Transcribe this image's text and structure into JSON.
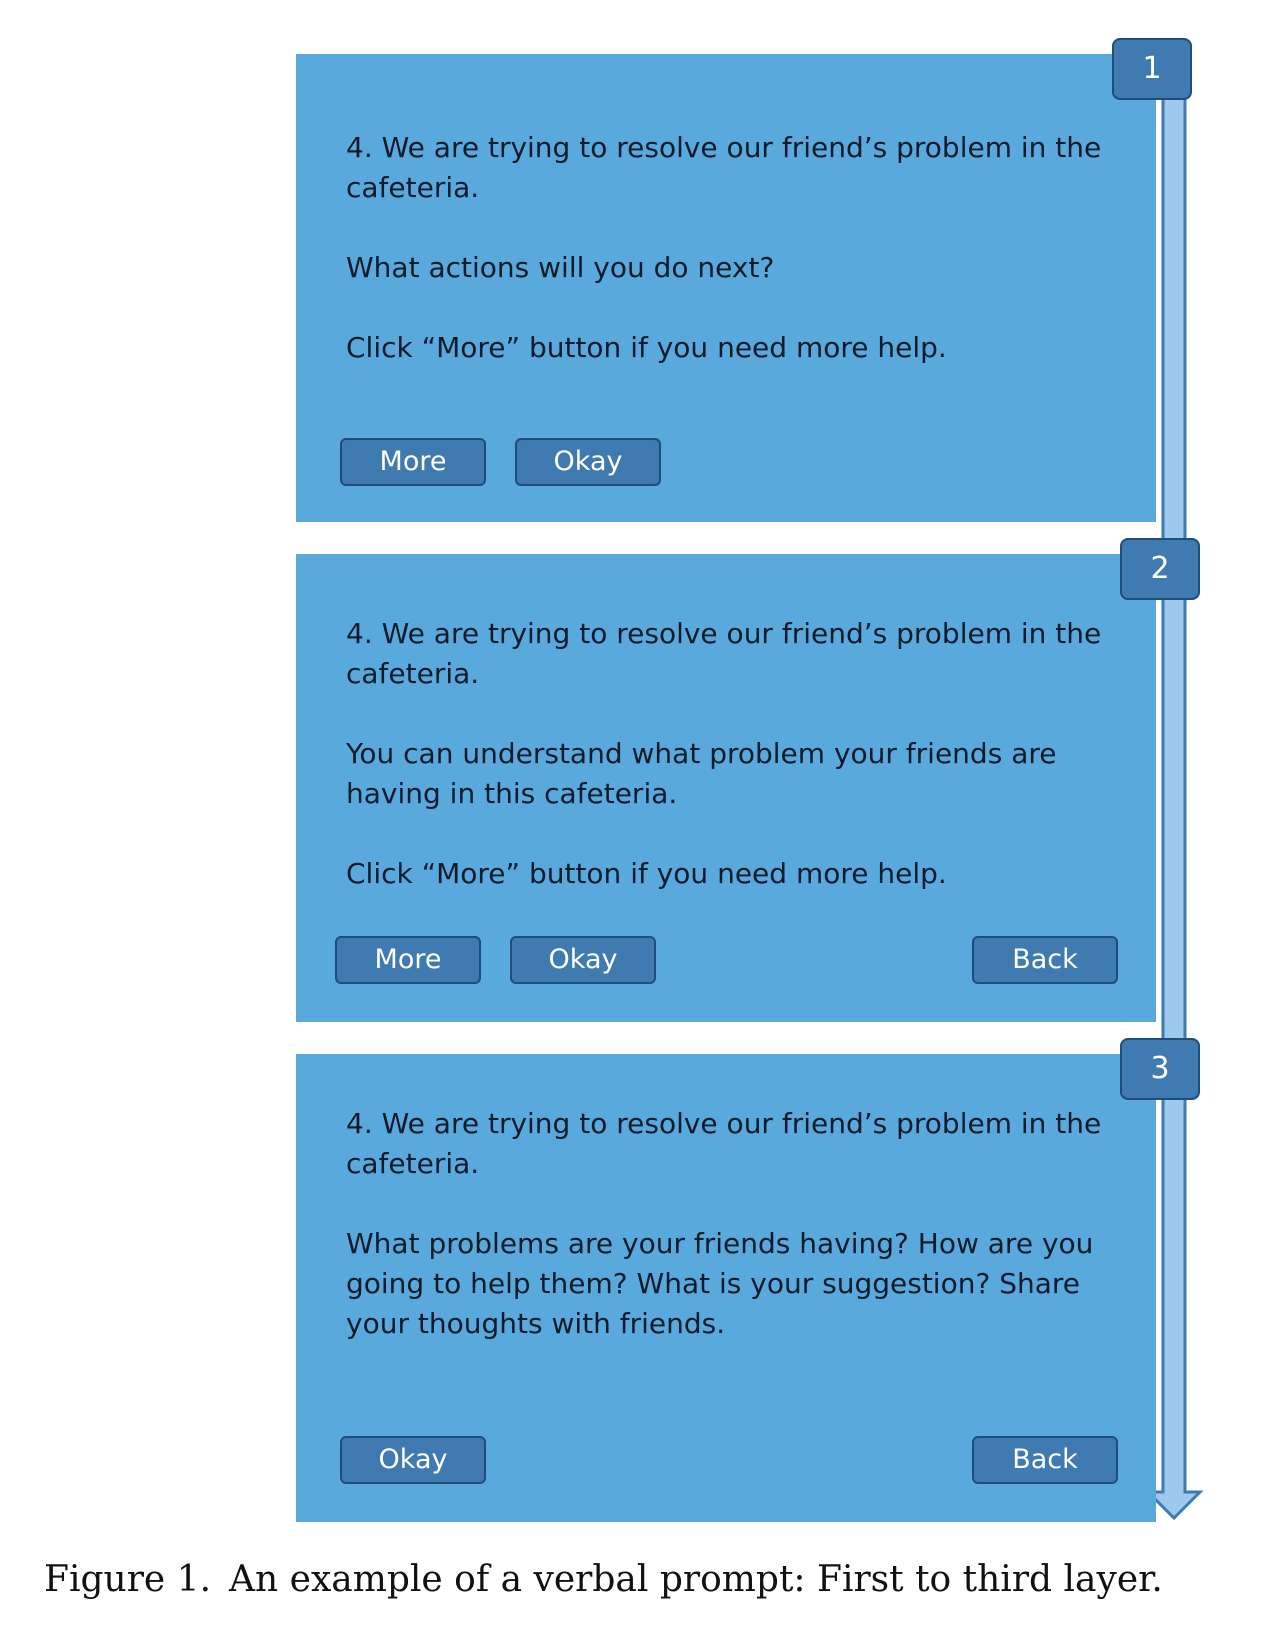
{
  "layers": [
    {
      "number": "1",
      "paragraphs": [
        "4. We are trying to resolve our friend’s problem in the cafeteria.",
        "What actions will you do next?",
        "Click “More” button if you need more help."
      ],
      "buttons": {
        "more": "More",
        "okay": "Okay"
      }
    },
    {
      "number": "2",
      "paragraphs": [
        "4. We are trying to resolve our friend’s problem in the cafeteria.",
        "You can understand what problem your friends are having in this cafeteria.",
        "Click “More” button if you need more help."
      ],
      "buttons": {
        "more": "More",
        "okay": "Okay",
        "back": "Back"
      }
    },
    {
      "number": "3",
      "paragraphs": [
        "4. We are trying to resolve our friend’s problem in the cafeteria.",
        "What problems are your friends having? How are you going to help them? What is your suggestion? Share your thoughts with friends."
      ],
      "buttons": {
        "okay": "Okay",
        "back": "Back"
      }
    }
  ],
  "caption": {
    "label": "Figure 1.",
    "text": "An example of a verbal prompt: First to third layer."
  },
  "colors": {
    "panel": "#5aa9dc",
    "button": "#3f7bb0",
    "button_border": "#1f4e7a",
    "arrow_fill": "#9cc9ec",
    "arrow_stroke": "#3f7bb0"
  }
}
